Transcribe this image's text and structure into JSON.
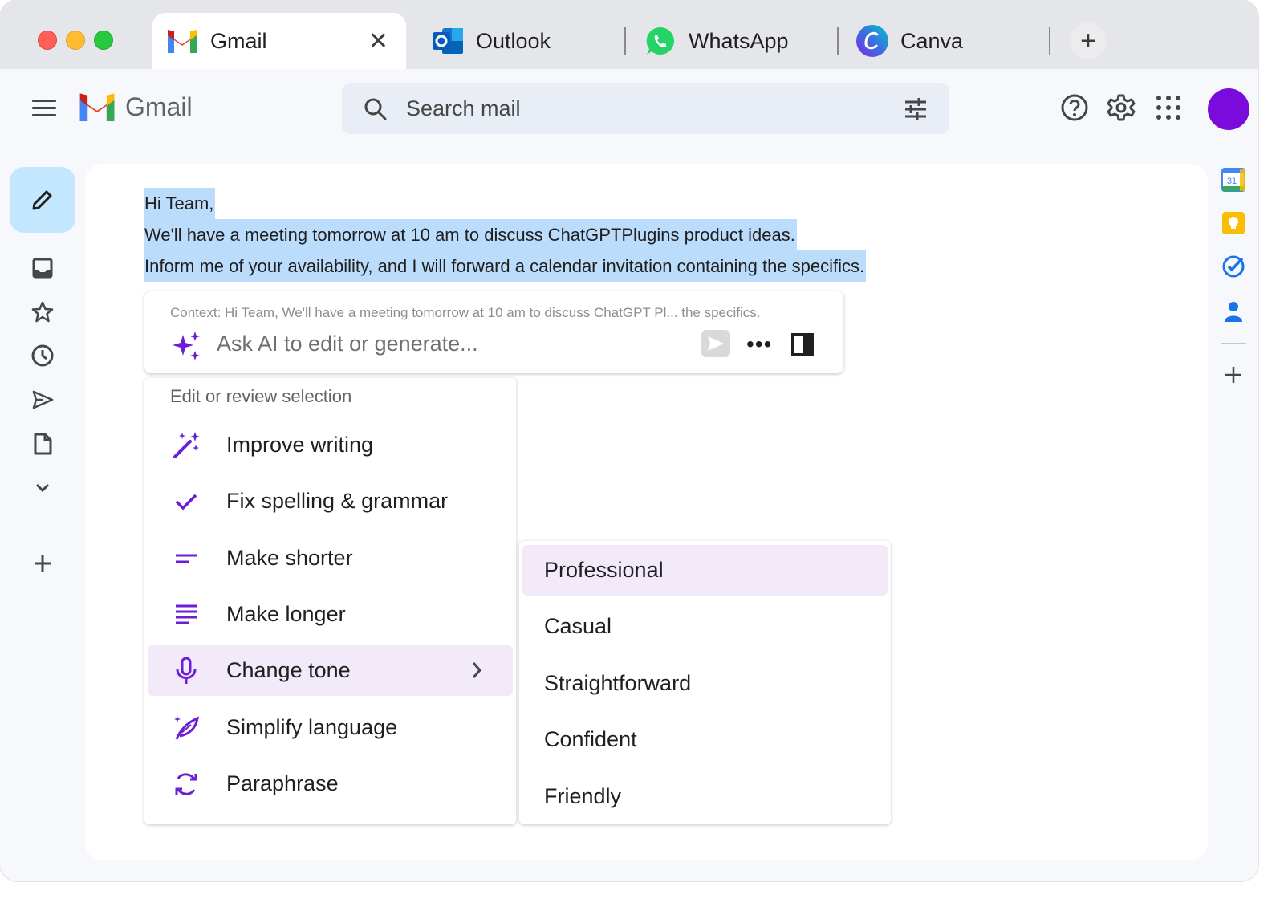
{
  "tabs": [
    {
      "label": "Gmail",
      "icon": "gmail-icon",
      "active": true
    },
    {
      "label": "Outlook",
      "icon": "outlook-icon"
    },
    {
      "label": "WhatsApp",
      "icon": "whatsapp-icon"
    },
    {
      "label": "Canva",
      "icon": "canva-icon"
    }
  ],
  "tab_close": "✕",
  "new_tab": "+",
  "header": {
    "brand": "Gmail",
    "search_placeholder": "Search mail"
  },
  "email": {
    "lines": [
      "Hi Team,",
      "We'll have a meeting tomorrow at 10 am to discuss ChatGPTPlugins product ideas.",
      "Inform me of your availability, and I will forward a calendar invitation containing the specifics."
    ]
  },
  "ai": {
    "context": "Context: Hi Team, We'll have a meeting tomorrow at 10 am to discuss ChatGPT Pl... the specifics.",
    "placeholder": "Ask AI to edit or generate...",
    "more": "•••"
  },
  "menu": {
    "header": "Edit or review selection",
    "items": [
      {
        "label": "Improve writing",
        "icon": "magic-wand-icon"
      },
      {
        "label": "Fix spelling & grammar",
        "icon": "checkmark-icon"
      },
      {
        "label": "Make shorter",
        "icon": "short-lines-icon"
      },
      {
        "label": "Make longer",
        "icon": "long-lines-icon"
      },
      {
        "label": "Change tone",
        "icon": "microphone-icon",
        "highlighted": true
      },
      {
        "label": "Simplify language",
        "icon": "feather-icon"
      },
      {
        "label": "Paraphrase",
        "icon": "refresh-icon"
      }
    ]
  },
  "tone_menu": {
    "items": [
      {
        "label": "Professional",
        "highlighted": true
      },
      {
        "label": "Casual"
      },
      {
        "label": "Straightforward"
      },
      {
        "label": "Confident"
      },
      {
        "label": "Friendly"
      }
    ]
  },
  "calendar_day": "31",
  "colors": {
    "accent": "#6a1ed6",
    "selection": "#bcdcfb",
    "compose": "#c2e7ff",
    "avatar": "#7a0bdc",
    "menu_highlight": "#f2e9f9"
  }
}
